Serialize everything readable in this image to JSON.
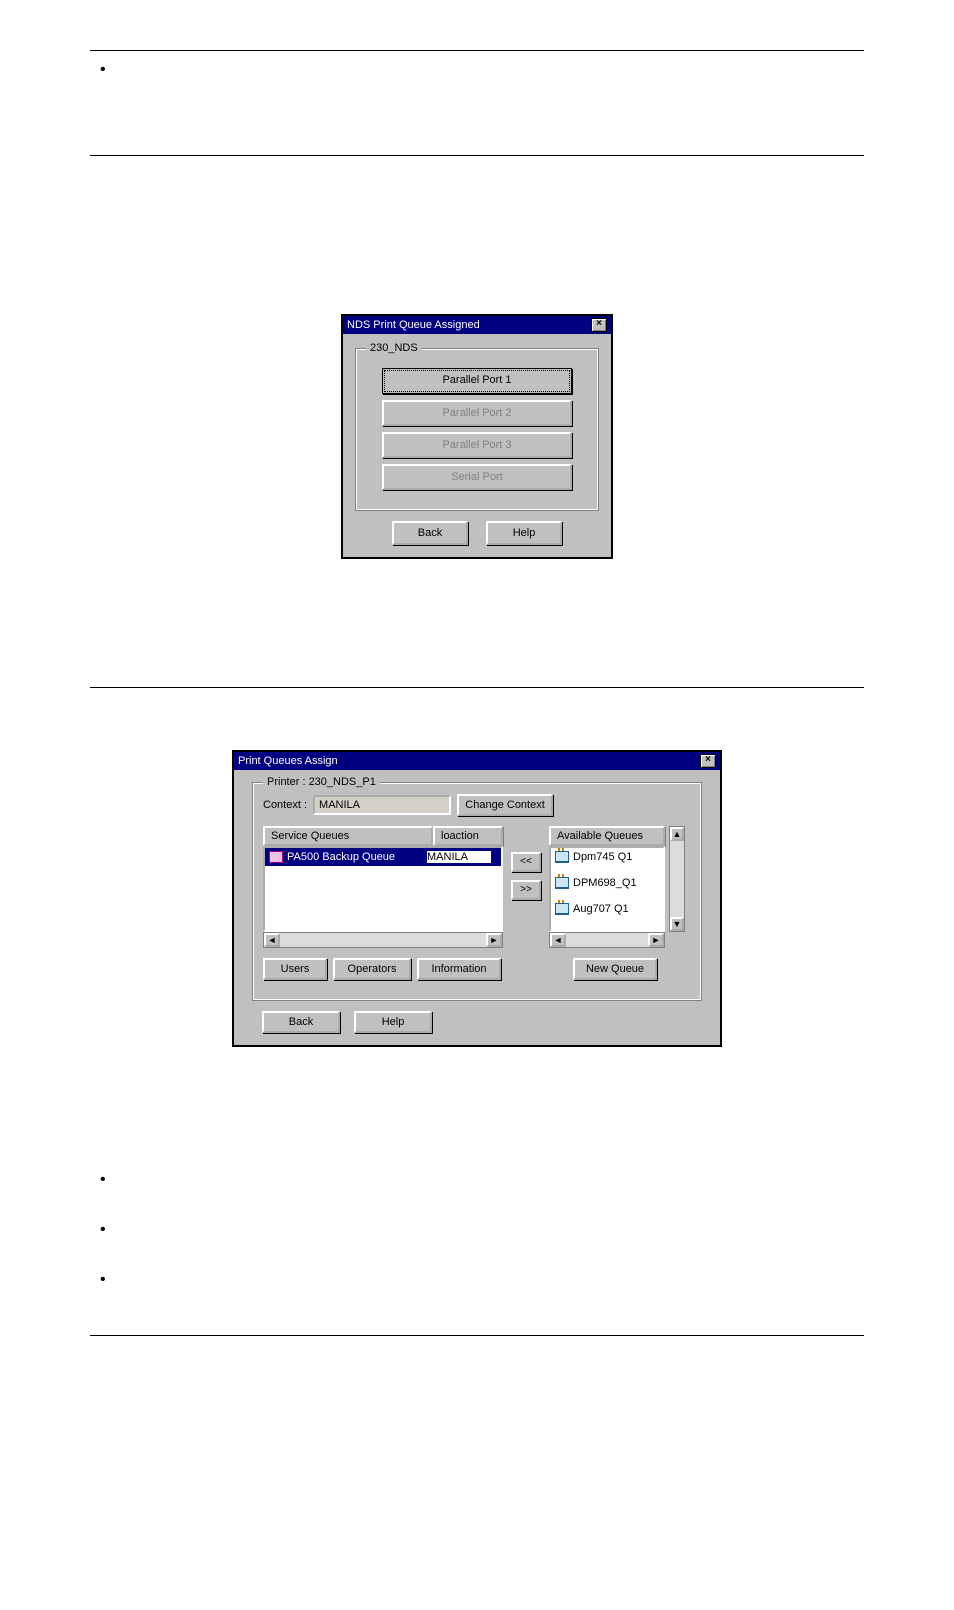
{
  "dialog1": {
    "title": "NDS Print Queue Assigned",
    "group_label": "230_NDS",
    "ports": {
      "p1": "Parallel Port 1",
      "p2": "Parallel Port 2",
      "p3": "Parallel Port 3",
      "serial": "Serial Port"
    },
    "back": "Back",
    "help": "Help"
  },
  "dialog2": {
    "title": "Print Queues Assign",
    "group_label": "Printer : 230_NDS_P1",
    "context_label": "Context :",
    "context_value": "MANILA",
    "change_context": "Change Context",
    "headers": {
      "service_queues": "Service Queues",
      "location": "loaction",
      "available_queues": "Available Queues"
    },
    "service_items": [
      {
        "name": "PA500 Backup Queue",
        "location": "MANILA"
      }
    ],
    "available_items": [
      {
        "name": "Dpm745 Q1"
      },
      {
        "name": "DPM698_Q1"
      },
      {
        "name": "Aug707 Q1"
      }
    ],
    "movers": {
      "left": "<<",
      "right": ">>"
    },
    "buttons": {
      "users": "Users",
      "operators": "Operators",
      "information": "Information",
      "new_queue": "New Queue",
      "back": "Back",
      "help": "Help"
    }
  }
}
